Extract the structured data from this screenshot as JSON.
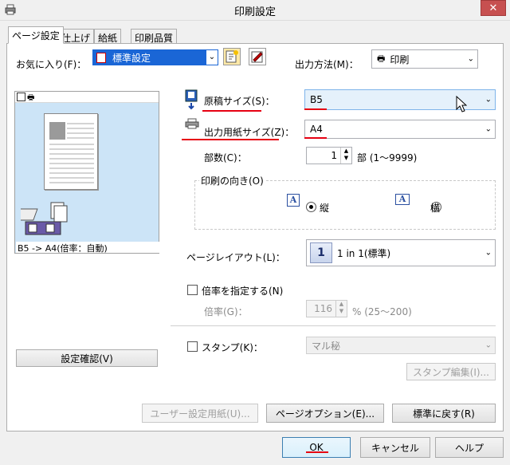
{
  "window": {
    "title": "印刷設定",
    "close_glyph": "✕"
  },
  "tabs": [
    {
      "label": "ページ設定",
      "active": true
    },
    {
      "label": "仕上げ"
    },
    {
      "label": "給紙"
    },
    {
      "label": "印刷品質"
    }
  ],
  "favorites": {
    "label": "お気に入り(F)：",
    "value": "標準設定"
  },
  "output_method": {
    "label": "出力方法(M)：",
    "value": "印刷"
  },
  "preview": {
    "caption": "B5 -> A4(倍率：自動)"
  },
  "original_size": {
    "label": "原稿サイズ(S)：",
    "value": "B5"
  },
  "output_paper_size": {
    "label": "出力用紙サイズ(Z)：",
    "value": "A4"
  },
  "copies": {
    "label": "部数(C)：",
    "value": "1",
    "unit": "部 (1～9999)"
  },
  "orientation": {
    "label": "印刷の向き(O)",
    "portrait": "縦",
    "landscape": "横",
    "selected": "portrait"
  },
  "page_layout": {
    "label": "ページレイアウト(L)：",
    "value": "1 in 1(標準)",
    "icon_number": "1"
  },
  "zoom": {
    "checkbox_label": "倍率を指定する(N)",
    "label": "倍率(G)：",
    "value": "116",
    "unit": "% (25～200)"
  },
  "stamp": {
    "checkbox_label": "スタンプ(K)：",
    "value": "マル秘",
    "edit_button": "スタンプ編集(I)..."
  },
  "confirm_settings_button": "設定確認(V)",
  "bottom_buttons": {
    "user_paper": "ユーザー設定用紙(U)...",
    "page_options": "ページオプション(E)...",
    "restore_default": "標準に戻す(R)"
  },
  "dialog_buttons": {
    "ok": "OK",
    "cancel": "キャンセル",
    "help": "ヘルプ"
  },
  "colors": {
    "accent_red": "#e60012",
    "preview_bg": "#cce4f7",
    "selection_blue": "#1a66d6"
  }
}
